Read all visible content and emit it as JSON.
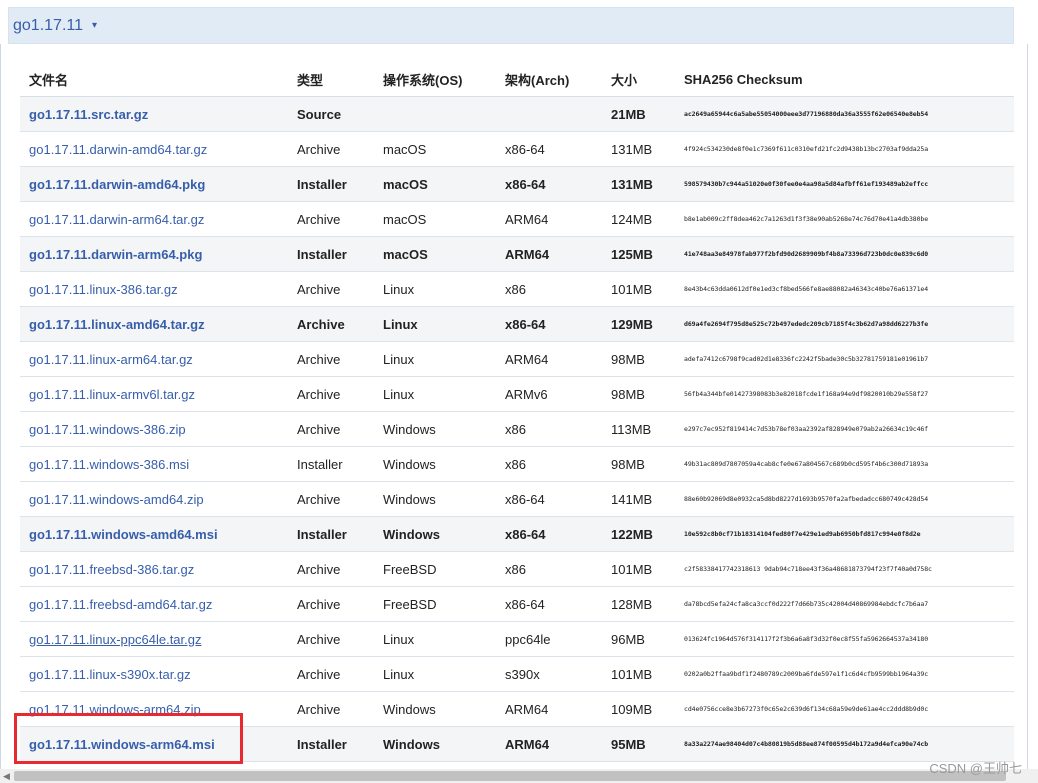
{
  "version": {
    "title": "go1.17.11",
    "caret": "▾"
  },
  "table": {
    "headers": [
      "文件名",
      "类型",
      "操作系统(OS)",
      "架构(Arch)",
      "大小",
      "SHA256 Checksum"
    ],
    "rows": [
      {
        "file": "go1.17.11.src.tar.gz",
        "kind": "Source",
        "os": "",
        "arch": "",
        "size": "21MB",
        "sha": "ac2649a65944c6a5abe55054000eee3d77196880da36a3555f62e06540e8eb54",
        "highlight": true,
        "underline": false
      },
      {
        "file": "go1.17.11.darwin-amd64.tar.gz",
        "kind": "Archive",
        "os": "macOS",
        "arch": "x86-64",
        "size": "131MB",
        "sha": "4f924c534230de8f0e1c7369f611c0310efd21fc2d9438b13bc2703af9dda25a",
        "highlight": false,
        "underline": false
      },
      {
        "file": "go1.17.11.darwin-amd64.pkg",
        "kind": "Installer",
        "os": "macOS",
        "arch": "x86-64",
        "size": "131MB",
        "sha": "598579430b7c944a51020e0f30fee0e4aa98a5d84afbff61ef193489ab2effcc",
        "highlight": true,
        "underline": false
      },
      {
        "file": "go1.17.11.darwin-arm64.tar.gz",
        "kind": "Archive",
        "os": "macOS",
        "arch": "ARM64",
        "size": "124MB",
        "sha": "b8e1ab009c2ff8dea462c7a1263d1f3f38e90ab5268e74c76d70e41a4db380be",
        "highlight": false,
        "underline": false
      },
      {
        "file": "go1.17.11.darwin-arm64.pkg",
        "kind": "Installer",
        "os": "macOS",
        "arch": "ARM64",
        "size": "125MB",
        "sha": "41e748aa3e84978fab977f2bfd90d2689909bf4b8a73396d723b0dc0e839c6d0",
        "highlight": true,
        "underline": false
      },
      {
        "file": "go1.17.11.linux-386.tar.gz",
        "kind": "Archive",
        "os": "Linux",
        "arch": "x86",
        "size": "101MB",
        "sha": "8e43b4c63dda0612df0e1ed3cf8bed566fe8ae88082a46343c40be76a61371e4",
        "highlight": false,
        "underline": false
      },
      {
        "file": "go1.17.11.linux-amd64.tar.gz",
        "kind": "Archive",
        "os": "Linux",
        "arch": "x86-64",
        "size": "129MB",
        "sha": "d69a4fe2694f795d8e525c72b497ededc209cb7185f4c3b62d7a98dd6227b3fe",
        "highlight": true,
        "underline": false
      },
      {
        "file": "go1.17.11.linux-arm64.tar.gz",
        "kind": "Archive",
        "os": "Linux",
        "arch": "ARM64",
        "size": "98MB",
        "sha": "adefa7412c6798f9cad02d1e8336fc2242f5bade30c5b32781759181e01961b7",
        "highlight": false,
        "underline": false
      },
      {
        "file": "go1.17.11.linux-armv6l.tar.gz",
        "kind": "Archive",
        "os": "Linux",
        "arch": "ARMv6",
        "size": "98MB",
        "sha": "56fb4a344bfe01427398083b3e82018fcde1f168a94e9df9820010b29e558f27",
        "highlight": false,
        "underline": false
      },
      {
        "file": "go1.17.11.windows-386.zip",
        "kind": "Archive",
        "os": "Windows",
        "arch": "x86",
        "size": "113MB",
        "sha": "e297c7ec952f819414c7d53b78ef03aa2392af828949e079ab2a26634c19c46f",
        "highlight": false,
        "underline": false
      },
      {
        "file": "go1.17.11.windows-386.msi",
        "kind": "Installer",
        "os": "Windows",
        "arch": "x86",
        "size": "98MB",
        "sha": "49b31ac809d7807059a4cab8cfe0e67a804567c689b0cd595f4b6c300d71893a",
        "highlight": false,
        "underline": false
      },
      {
        "file": "go1.17.11.windows-amd64.zip",
        "kind": "Archive",
        "os": "Windows",
        "arch": "x86-64",
        "size": "141MB",
        "sha": "88e60b92069d8e0932ca5d8bd8227d1693b9570fa2afbedadcc680749c428d54",
        "highlight": false,
        "underline": false
      },
      {
        "file": "go1.17.11.windows-amd64.msi",
        "kind": "Installer",
        "os": "Windows",
        "arch": "x86-64",
        "size": "122MB",
        "sha": "10e592c8b0cf71b18314104fed80f7e429e1ed9ab6950bfd817c994e0f8d2e",
        "highlight": true,
        "underline": false
      },
      {
        "file": "go1.17.11.freebsd-386.tar.gz",
        "kind": "Archive",
        "os": "FreeBSD",
        "arch": "x86",
        "size": "101MB",
        "sha": "c2f58338417742318613 9dab94c718ee43f36a48681873794f23f7f40a0d758c",
        "highlight": false,
        "underline": false
      },
      {
        "file": "go1.17.11.freebsd-amd64.tar.gz",
        "kind": "Archive",
        "os": "FreeBSD",
        "arch": "x86-64",
        "size": "128MB",
        "sha": "da78bcd5efa24cfa8ca3ccf0d222f7d66b735c42004d40869984ebdcfc7b6aa7",
        "highlight": false,
        "underline": false
      },
      {
        "file": "go1.17.11.linux-ppc64le.tar.gz",
        "kind": "Archive",
        "os": "Linux",
        "arch": "ppc64le",
        "size": "96MB",
        "sha": "013624fc1964d576f314117f2f3b6a6a8f3d32f0ec8f55fa5962664537a34180",
        "highlight": false,
        "underline": true
      },
      {
        "file": "go1.17.11.linux-s390x.tar.gz",
        "kind": "Archive",
        "os": "Linux",
        "arch": "s390x",
        "size": "101MB",
        "sha": "0202a0b2ffaa9bdf1f2480789c2009ba6fde597e1f1c6d4cfb9599bb1964a39c",
        "highlight": false,
        "underline": false
      },
      {
        "file": "go1.17.11.windows-arm64.zip",
        "kind": "Archive",
        "os": "Windows",
        "arch": "ARM64",
        "size": "109MB",
        "sha": "cd4e0756cce8e3b67273f0c65e2c639d6f134c68a59e9de61ae4cc2ddd8b9d0c",
        "highlight": false,
        "underline": false
      },
      {
        "file": "go1.17.11.windows-arm64.msi",
        "kind": "Installer",
        "os": "Windows",
        "arch": "ARM64",
        "size": "95MB",
        "sha": "8a33a2274ae98404d07c4b80819b5d88ee874f00595d4b172a9d4efca90e74cb",
        "highlight": true,
        "underline": false
      }
    ]
  },
  "watermark": "CSDN @王帅七"
}
